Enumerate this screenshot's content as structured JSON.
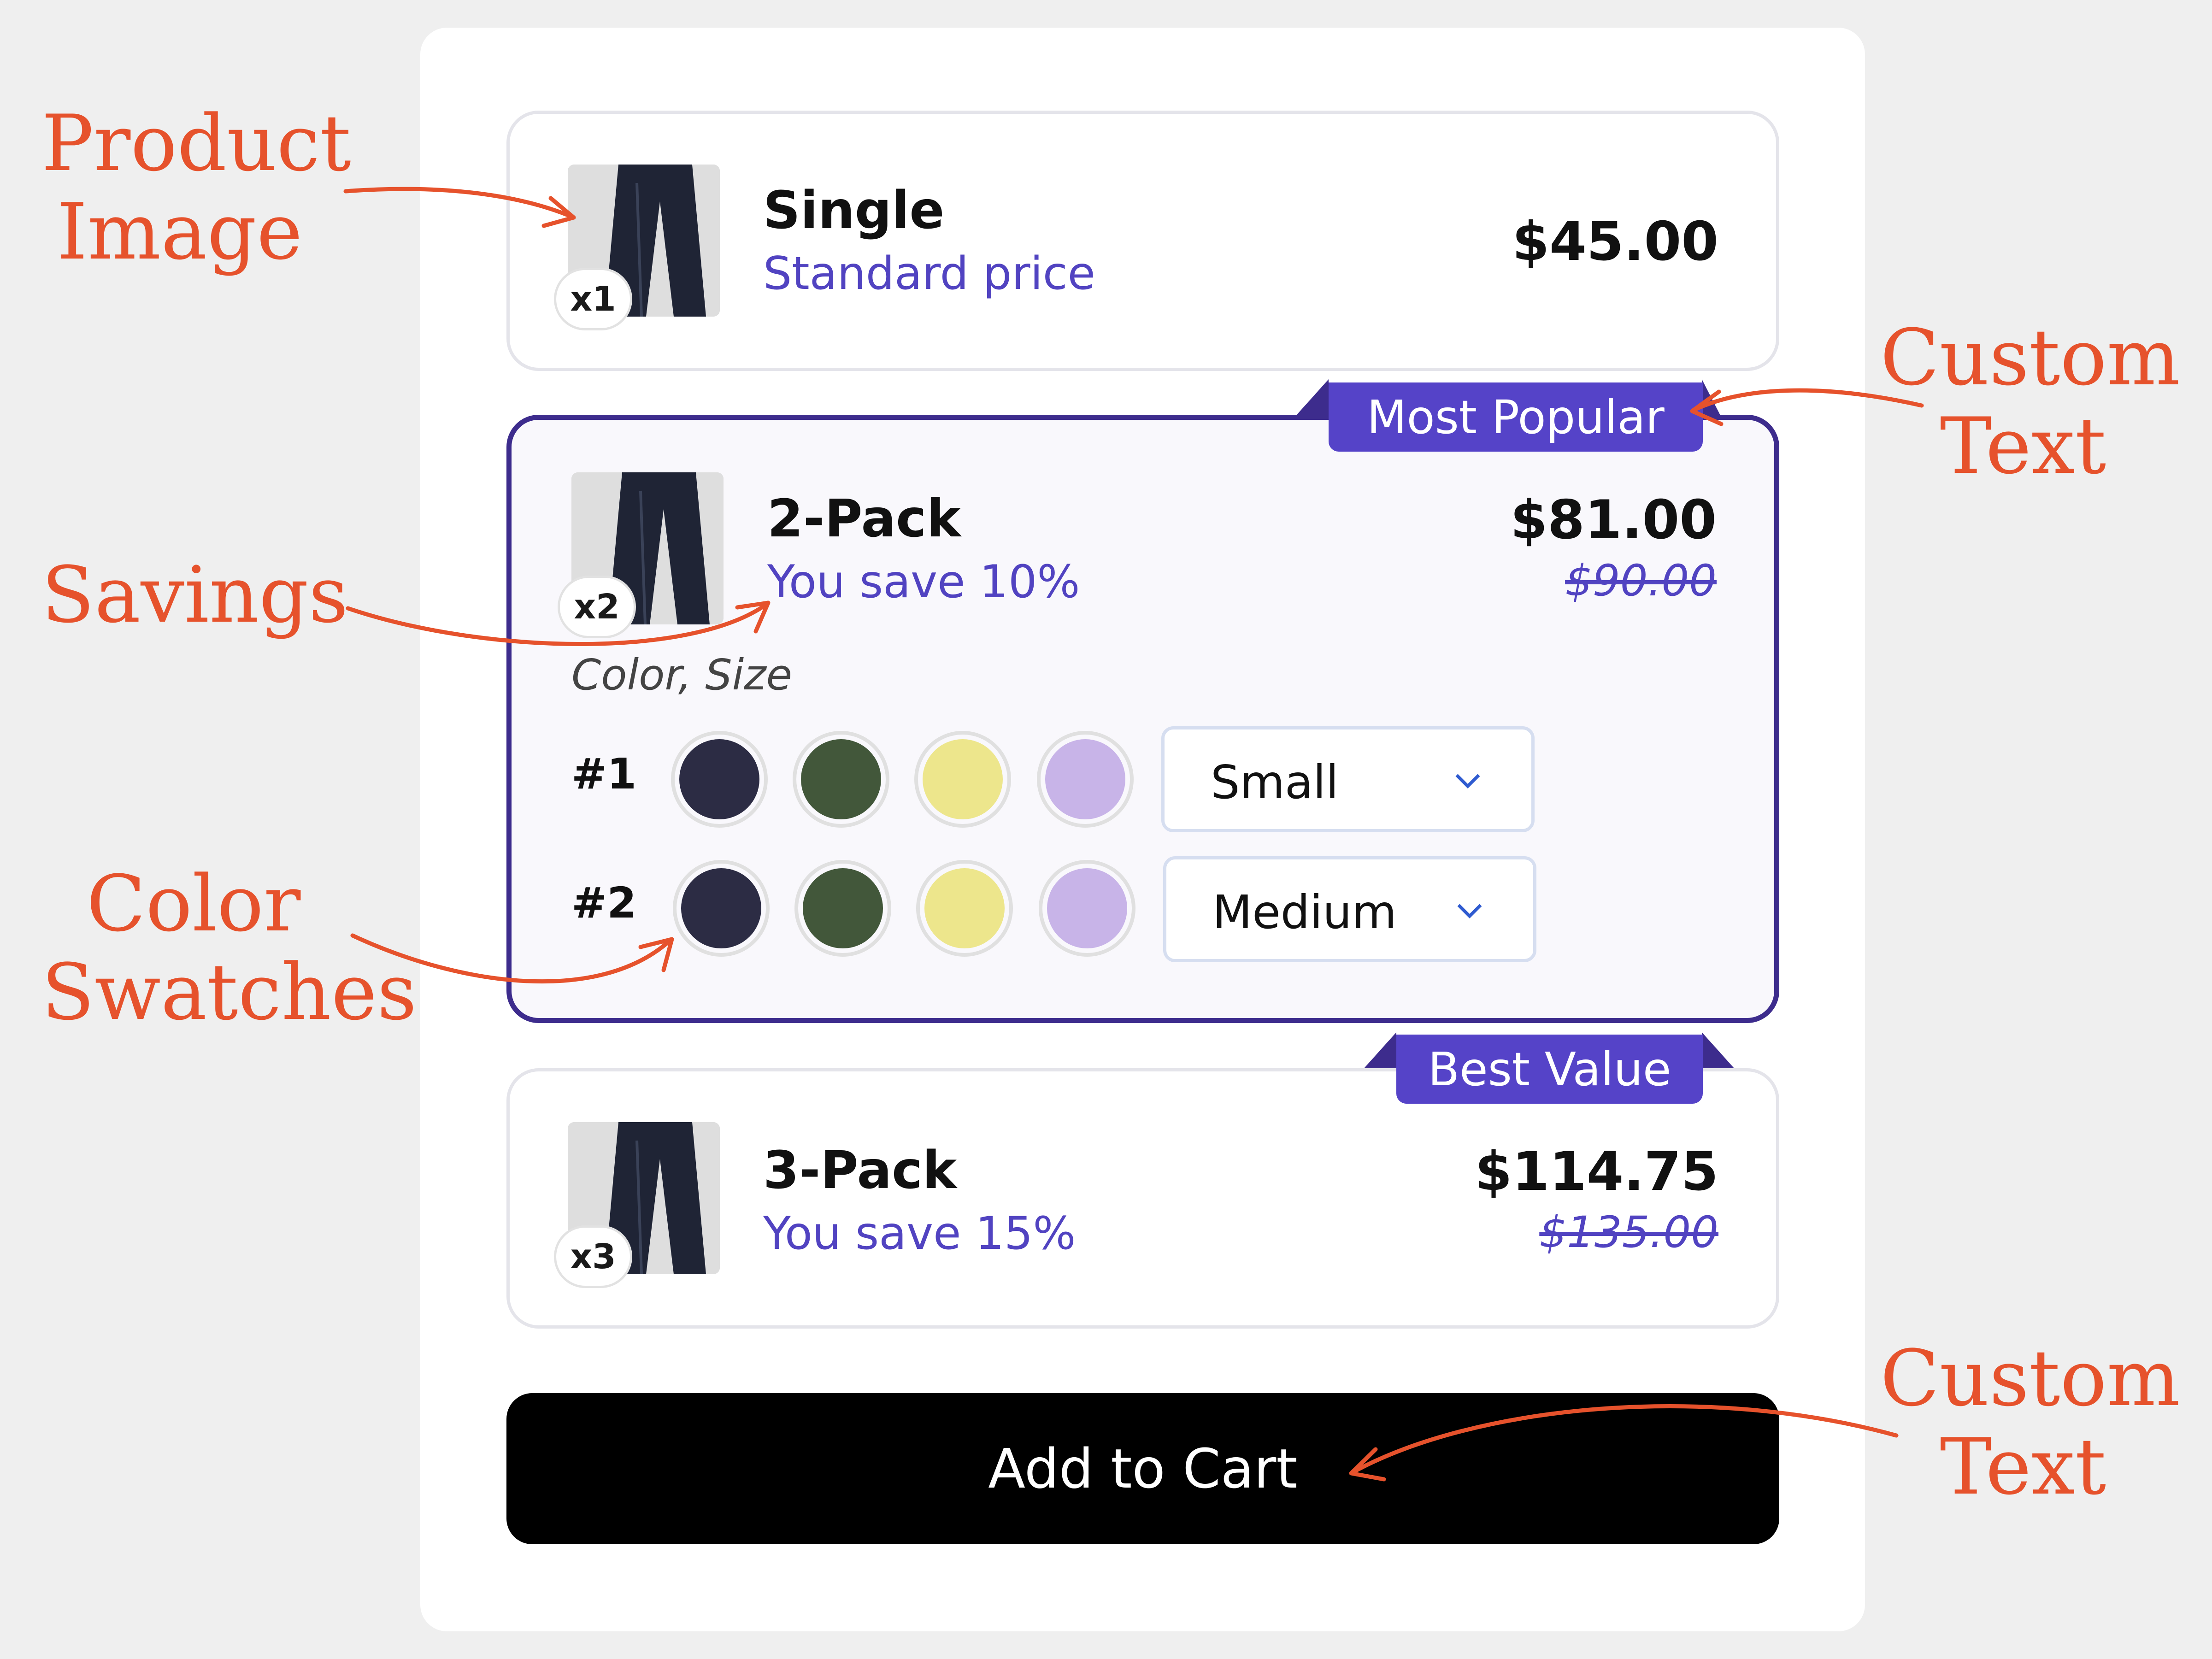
{
  "annotations": {
    "product_image": [
      "Product",
      "Image"
    ],
    "savings": "Savings",
    "color_swatches": [
      "Color",
      "Swatches"
    ],
    "custom_text_top": [
      "Custom",
      "Text"
    ],
    "custom_text_bottom": [
      "Custom",
      "Text"
    ]
  },
  "colors": {
    "accent": "#5543c8",
    "selected_border": "#3d2c8d",
    "annotation": "#e6522c",
    "swatches": [
      "#2c2c44",
      "#42573a",
      "#ede68c",
      "#c8b4e8"
    ]
  },
  "bundles": [
    {
      "title": "Single",
      "subtitle": "Standard price",
      "price": "$45.00",
      "qty": "x1",
      "badge": ""
    },
    {
      "title": "2-Pack",
      "subtitle": "You save 10%",
      "price": "$81.00",
      "original_price": "$90.00",
      "qty": "x2",
      "badge": "Most Popular",
      "selected": true,
      "options_label": "Color, Size",
      "variants": [
        {
          "label": "#1",
          "size": "Small"
        },
        {
          "label": "#2",
          "size": "Medium"
        }
      ]
    },
    {
      "title": "3-Pack",
      "subtitle": "You save 15%",
      "price": "$114.75",
      "original_price": "$135.00",
      "qty": "x3",
      "badge": "Best Value"
    }
  ],
  "add_to_cart_label": "Add to Cart"
}
